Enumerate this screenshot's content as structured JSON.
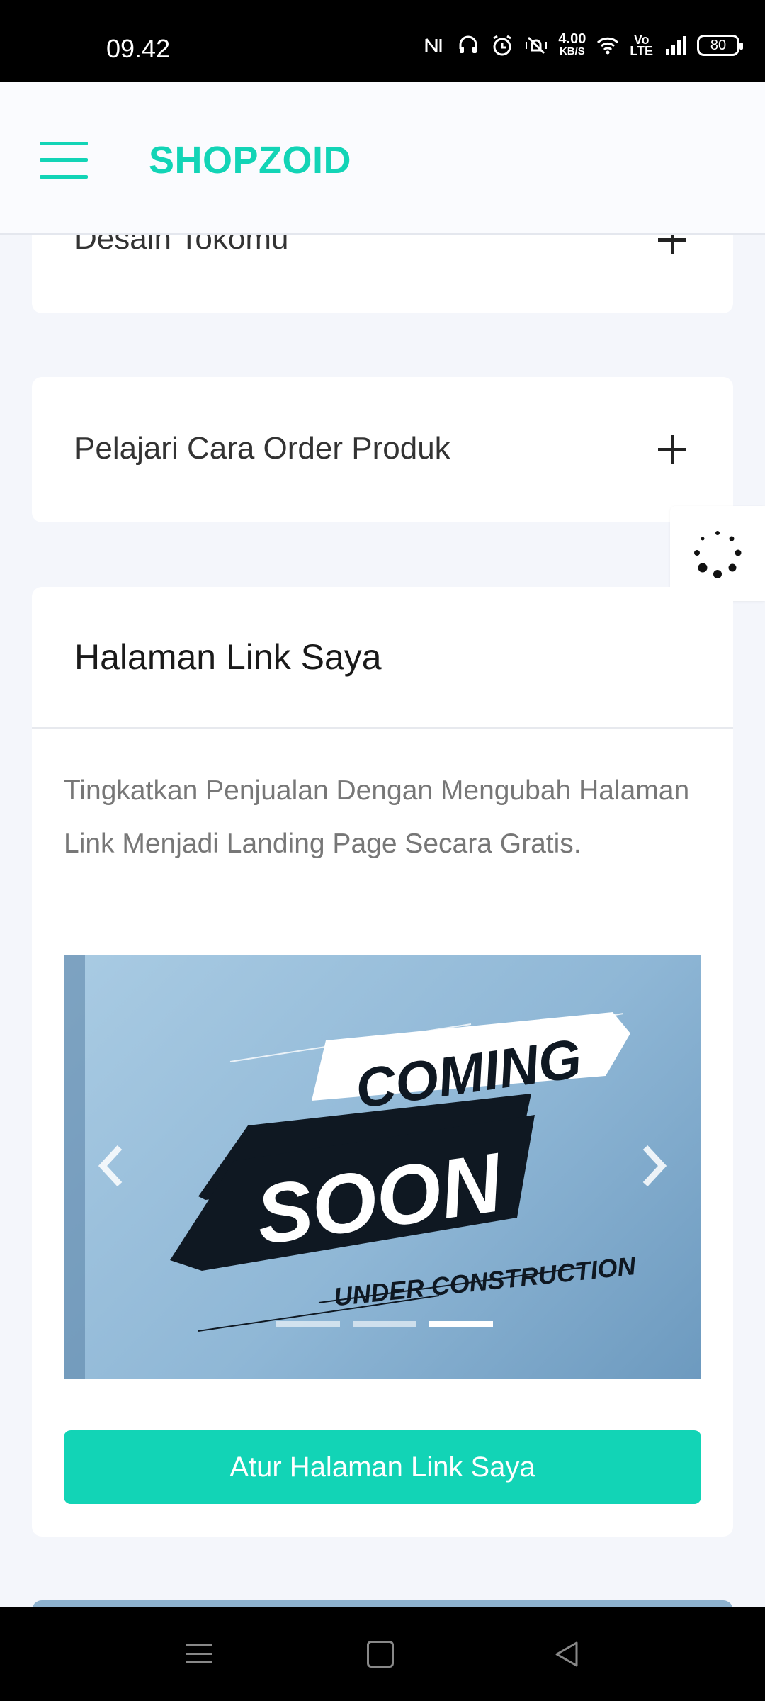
{
  "status_bar": {
    "time": "09.42",
    "speed_value": "4.00",
    "speed_unit": "KB/S",
    "volte_top": "Vo",
    "volte_bottom": "LTE",
    "battery": "80",
    "icons": [
      "nfc-icon",
      "headset-icon",
      "alarm-icon",
      "vibrate-icon",
      "wifi-icon",
      "volte-icon",
      "signal-icon",
      "battery-icon"
    ]
  },
  "header": {
    "brand": "SHOPZOID",
    "brand_color": "#12d4b6",
    "menu_icon": "hamburger-menu-icon"
  },
  "accordion": {
    "item1": "Desain Tokomu",
    "item2": "Pelajari Cara Order Produk"
  },
  "link_page": {
    "title": "Halaman Link Saya",
    "description": "Tingkatkan Penjualan Dengan Mengubah Halaman Link Menjadi Landing Page Secara Gratis.",
    "carousel": {
      "line1": "COMING",
      "line2": "SOON",
      "line3": "UNDER CONSTRUCTION",
      "slide_count": 3,
      "active_slide": 3
    },
    "cta_label": "Atur Halaman Link Saya",
    "cta_color": "#12d4b6"
  }
}
